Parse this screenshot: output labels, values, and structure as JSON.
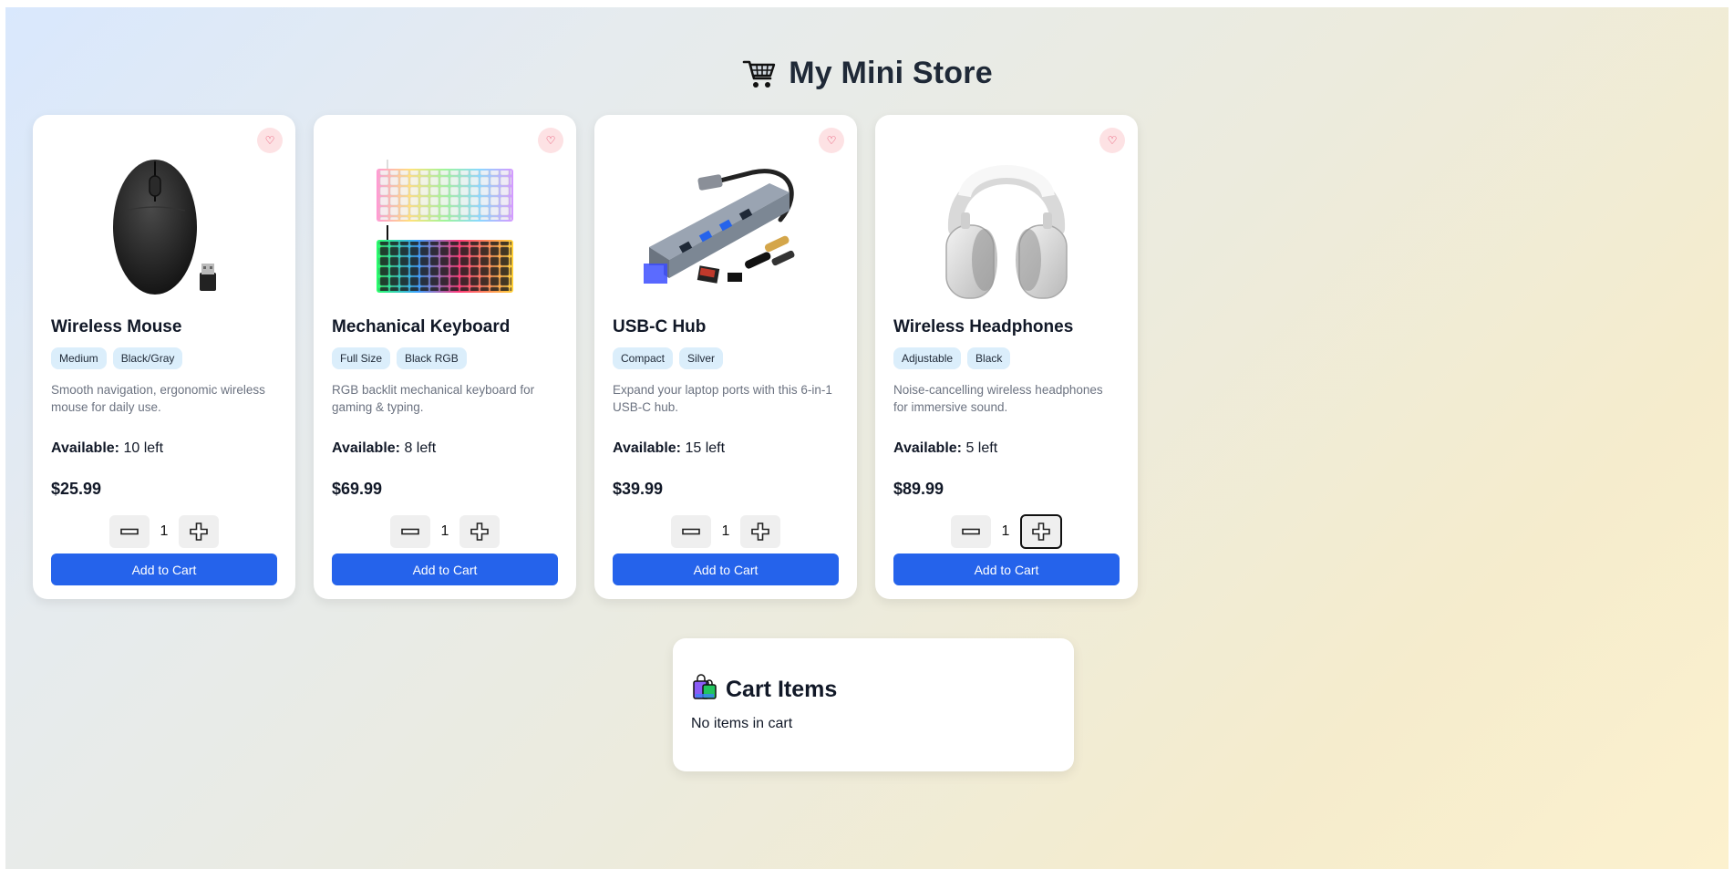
{
  "store": {
    "title": "My Mini Store",
    "icon": "shopping-cart-icon"
  },
  "products": [
    {
      "name": "Wireless Mouse",
      "tags": [
        "Medium",
        "Black/Gray"
      ],
      "description": "Smooth navigation, ergonomic wireless mouse for daily use.",
      "available_label": "Available:",
      "available_value": "10 left",
      "price": "$25.99",
      "quantity": "1",
      "add_label": "Add to Cart",
      "image": "wireless-mouse-image"
    },
    {
      "name": "Mechanical Keyboard",
      "tags": [
        "Full Size",
        "Black RGB"
      ],
      "description": "RGB backlit mechanical keyboard for gaming & typing.",
      "available_label": "Available:",
      "available_value": "8 left",
      "price": "$69.99",
      "quantity": "1",
      "add_label": "Add to Cart",
      "image": "keyboard-image"
    },
    {
      "name": "USB-C Hub",
      "tags": [
        "Compact",
        "Silver"
      ],
      "description": "Expand your laptop ports with this 6-in-1 USB-C hub.",
      "available_label": "Available:",
      "available_value": "15 left",
      "price": "$39.99",
      "quantity": "1",
      "add_label": "Add to Cart",
      "image": "usb-hub-image"
    },
    {
      "name": "Wireless Headphones",
      "tags": [
        "Adjustable",
        "Black"
      ],
      "description": "Noise-cancelling wireless headphones for immersive sound.",
      "available_label": "Available:",
      "available_value": "5 left",
      "price": "$89.99",
      "quantity": "1",
      "add_label": "Add to Cart",
      "image": "headphones-image"
    }
  ],
  "cart": {
    "title": "Cart Items",
    "icon": "shopping-bags-icon",
    "empty_text": "No items in cart"
  },
  "colors": {
    "accent": "#2563eb",
    "tag_bg": "#dbeefb",
    "heart_bg": "#fde2e4"
  }
}
